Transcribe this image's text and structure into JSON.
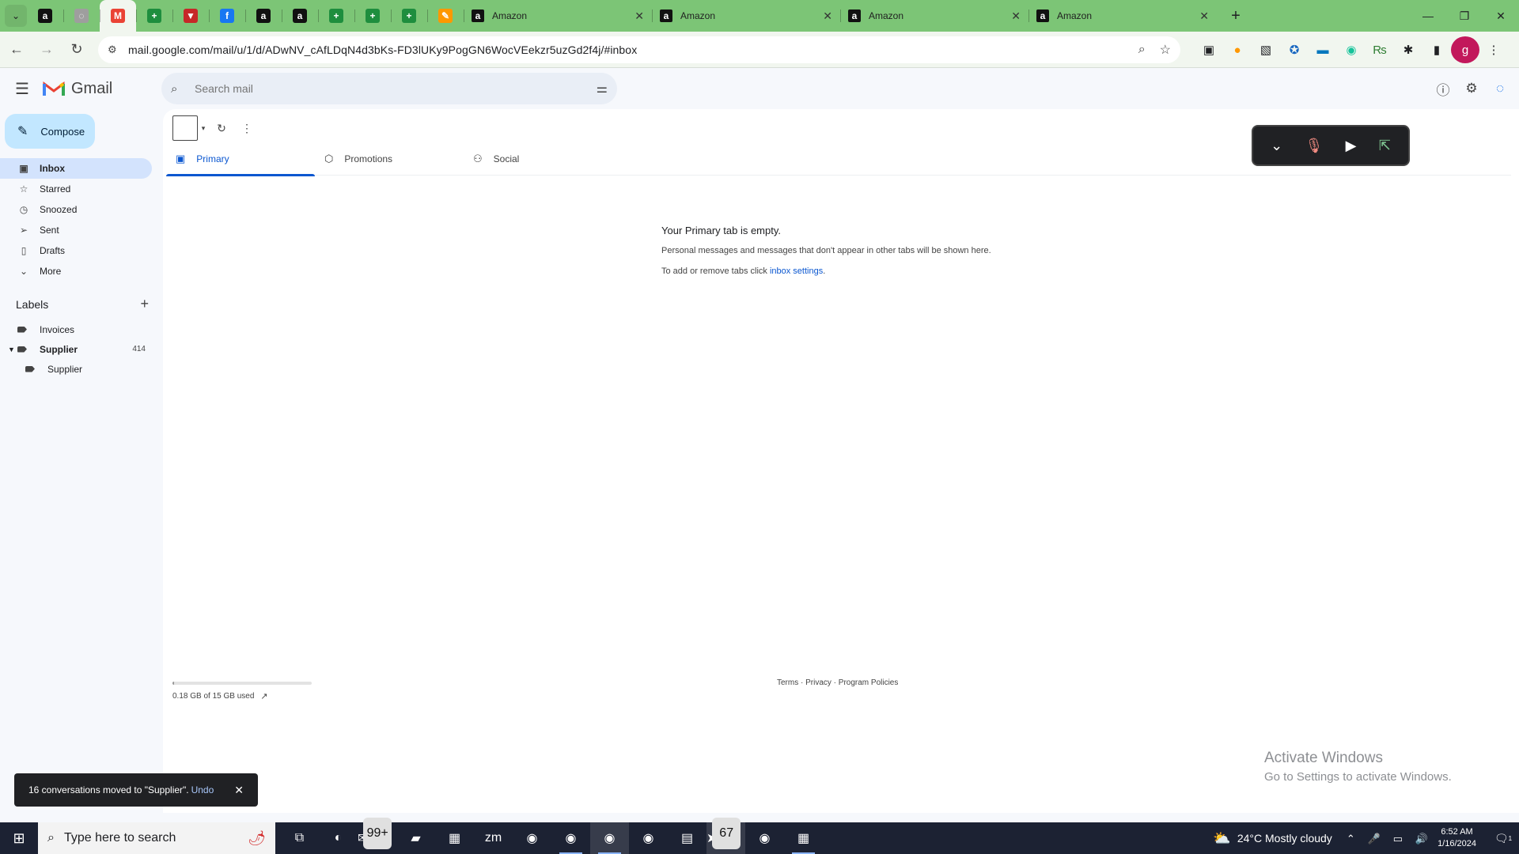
{
  "browser": {
    "pinned_tabs": [
      {
        "icon": "amazon-icon",
        "glyph": "a",
        "color": "#111111"
      },
      {
        "icon": "globe-icon",
        "glyph": "◌",
        "color": "#9e9e9e"
      },
      {
        "icon": "gmail-icon",
        "glyph": "M",
        "color": "#ea4335"
      },
      {
        "icon": "sheet-plus-icon",
        "glyph": "+",
        "color": "#1e8e3e"
      },
      {
        "icon": "ribbon-icon",
        "glyph": "▼",
        "color": "#c62828"
      },
      {
        "icon": "facebook-icon",
        "glyph": "f",
        "color": "#1877f2"
      },
      {
        "icon": "amazon-icon",
        "glyph": "a",
        "color": "#111111"
      },
      {
        "icon": "amazon-icon",
        "glyph": "a",
        "color": "#111111"
      },
      {
        "icon": "sheet-plus-icon",
        "glyph": "+",
        "color": "#1e8e3e"
      },
      {
        "icon": "sheet-plus-icon",
        "glyph": "+",
        "color": "#1e8e3e"
      },
      {
        "icon": "sheet-plus-icon",
        "glyph": "+",
        "color": "#1e8e3e"
      },
      {
        "icon": "colorful-app-icon",
        "glyph": "✎",
        "color": "#ff9800"
      }
    ],
    "tabs": [
      {
        "title": "Amazon"
      },
      {
        "title": "Amazon"
      },
      {
        "title": "Amazon"
      },
      {
        "title": "Amazon"
      }
    ],
    "url": "mail.google.com/mail/u/1/d/ADwNV_cAfLDqN4d3bKs-FD3lUKy9PogGN6WocVEekzr5uzGd2f4j/#inbox",
    "profile_initial": "g"
  },
  "gmail": {
    "logo_text": "Gmail",
    "search_placeholder": "Search mail",
    "compose_label": "Compose",
    "nav": [
      {
        "label": "Inbox",
        "icon": "inbox-icon",
        "glyph": "▣",
        "active": true
      },
      {
        "label": "Starred",
        "icon": "star-icon",
        "glyph": "☆"
      },
      {
        "label": "Snoozed",
        "icon": "clock-icon",
        "glyph": "◷"
      },
      {
        "label": "Sent",
        "icon": "send-icon",
        "glyph": "➢"
      },
      {
        "label": "Drafts",
        "icon": "draft-icon",
        "glyph": "▯"
      },
      {
        "label": "More",
        "icon": "chevron-down-icon",
        "glyph": "⌄"
      }
    ],
    "labels_title": "Labels",
    "labels": [
      {
        "name": "Invoices",
        "count": ""
      },
      {
        "name": "Supplier",
        "count": "414",
        "bold": true,
        "expanded": true
      },
      {
        "name": "Supplier",
        "count": "",
        "child": true
      }
    ],
    "tabs": [
      {
        "label": "Primary",
        "icon": "inbox-icon",
        "glyph": "▣",
        "active": true
      },
      {
        "label": "Promotions",
        "icon": "tag-icon",
        "glyph": "⬡"
      },
      {
        "label": "Social",
        "icon": "people-icon",
        "glyph": "⚇"
      }
    ],
    "empty": {
      "title": "Your Primary tab is empty.",
      "line1": "Personal messages and messages that don't appear in other tabs will be shown here.",
      "line2_prefix": "To add or remove tabs click ",
      "line2_link": "inbox settings",
      "line2_suffix": "."
    },
    "storage": {
      "text": "0.18 GB of 15 GB used",
      "fraction": 0.012
    },
    "footer": "Terms · Privacy · Program Policies",
    "toast": {
      "message": "16 conversations moved to \"Supplier\".",
      "action": "Undo"
    }
  },
  "watermark": {
    "line1": "Activate Windows",
    "line2": "Go to Settings to activate Windows."
  },
  "taskbar": {
    "search_placeholder": "Type here to search",
    "apps": [
      {
        "icon": "task-view-icon",
        "glyph": "⧉"
      },
      {
        "icon": "edge-icon",
        "glyph": "◐"
      },
      {
        "icon": "mail-app-icon",
        "glyph": "✉",
        "badge": "99+"
      },
      {
        "icon": "file-explorer-icon",
        "glyph": "▰"
      },
      {
        "icon": "store-icon",
        "glyph": "▦"
      },
      {
        "icon": "zoom-icon",
        "glyph": "zm"
      },
      {
        "icon": "chrome-icon",
        "glyph": "◉"
      },
      {
        "icon": "chrome-icon",
        "glyph": "◉",
        "on": true
      },
      {
        "icon": "chrome-icon",
        "glyph": "◉",
        "on": true,
        "active": true
      },
      {
        "icon": "chrome-icon",
        "glyph": "◉"
      },
      {
        "icon": "sticky-notes-icon",
        "glyph": "▤"
      },
      {
        "icon": "telegram-icon",
        "glyph": "➤",
        "badge": "67",
        "active": true
      },
      {
        "icon": "chrome-icon",
        "glyph": "◉"
      },
      {
        "icon": "calculator-icon",
        "glyph": "▦",
        "on": true
      }
    ],
    "weather_temp": "24°C",
    "weather_text": "Mostly cloudy",
    "time": "6:52 AM",
    "date": "1/16/2024",
    "notification_count": "1"
  }
}
